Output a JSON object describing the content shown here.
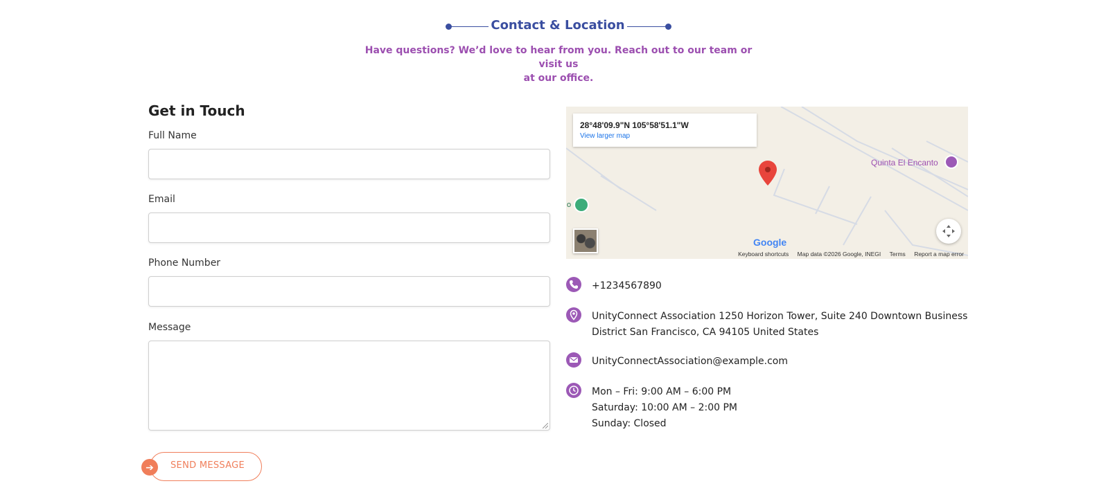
{
  "header": {
    "title": "Contact & Location",
    "subtitle_line1": "Have questions? We’d love to hear from you. Reach out to our team or visit us",
    "subtitle_line2": "at our office."
  },
  "form": {
    "title": "Get in Touch",
    "fields": [
      {
        "label": "Full Name",
        "value": "",
        "placeholder": ""
      },
      {
        "label": "Email",
        "value": "",
        "placeholder": ""
      },
      {
        "label": "Phone Number",
        "value": "",
        "placeholder": ""
      },
      {
        "label": "Message",
        "value": "",
        "placeholder": ""
      }
    ],
    "submit_label": "SEND MESSAGE"
  },
  "map": {
    "coordinates": "28°48'09.9\"N 105°58'51.1\"W",
    "view_larger_label": "View larger map",
    "poi_label": "Quinta El Encanto",
    "park_label": "o",
    "logo": "Google",
    "footer_links": [
      "Keyboard shortcuts",
      "Map data ©2026 Google, INEGI",
      "Terms",
      "Report a map error"
    ]
  },
  "contact": {
    "phone": "+1234567890",
    "address_line1": "UnityConnect Association 1250 Horizon Tower, Suite 240 Downtown Business",
    "address_line2": "District San Francisco, CA 94105 United States",
    "email": "UnityConnectAssociation@example.com",
    "hours_line1": "Mon – Fri: 9:00 AM – 6:00 PM",
    "hours_line2": "Saturday: 10:00 AM – 2:00 PM",
    "hours_line3": "Sunday: Closed"
  },
  "colors": {
    "heading_blue": "#3a4ea0",
    "subtitle_purple": "#9c4fb0",
    "icon_purple": "#9c59b6",
    "button_orange": "#f07e5a"
  },
  "icons": {
    "phone": "phone-icon",
    "address": "map-pin-icon",
    "email": "envelope-icon",
    "hours": "clock-icon",
    "submit": "arrow-right-icon"
  }
}
